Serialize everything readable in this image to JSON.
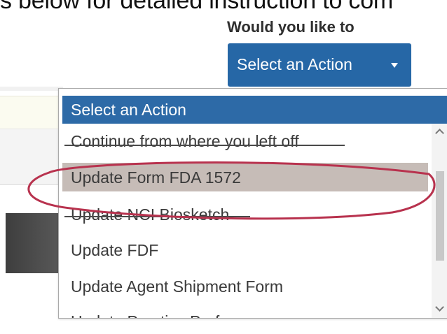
{
  "instruction_text": "s below for detailed instruction to com",
  "action_prompt": {
    "question": "Would you like to",
    "button_label": "Select an Action"
  },
  "dropdown": {
    "header": "Select an Action",
    "options": [
      {
        "label": "Continue from where you left off",
        "crossed_out": true
      },
      {
        "label": "Update Form FDA 1572",
        "highlighted": true,
        "circled": true
      },
      {
        "label": "Update NCI Biosketch",
        "crossed_out": true
      },
      {
        "label": "Update FDF"
      },
      {
        "label": "Update Agent Shipment Form"
      },
      {
        "label": "Update Practice Preferences"
      }
    ]
  },
  "colors": {
    "primary_button": "#2667a6",
    "dropdown_header": "#2d6aa7",
    "highlight": "#c6bcb7",
    "annotation_circle": "#b8324e"
  },
  "icons": [
    "dropdown-caret-icon",
    "scroll-up-icon",
    "scroll-down-icon"
  ]
}
